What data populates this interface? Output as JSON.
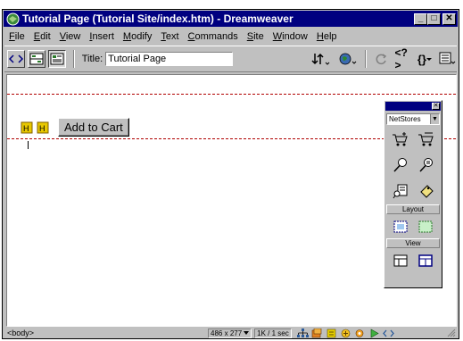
{
  "window": {
    "title": "Tutorial Page (Tutorial Site/index.htm) - Dreamweaver",
    "controls": {
      "minimize": "_",
      "maximize": "□",
      "close": "✕"
    }
  },
  "menu": [
    {
      "accel": "F",
      "rest": "ile"
    },
    {
      "accel": "E",
      "rest": "dit"
    },
    {
      "accel": "V",
      "rest": "iew"
    },
    {
      "accel": "I",
      "rest": "nsert"
    },
    {
      "accel": "M",
      "rest": "odify"
    },
    {
      "accel": "T",
      "rest": "ext"
    },
    {
      "accel": "C",
      "rest": "ommands"
    },
    {
      "accel": "S",
      "rest": "ite"
    },
    {
      "accel": "W",
      "rest": "indow"
    },
    {
      "accel": "H",
      "rest": "elp"
    }
  ],
  "toolbar": {
    "title_label": "Title:",
    "title_value": "Tutorial Page",
    "icons": [
      "code-view-icon",
      "split-view-icon",
      "design-view-icon",
      "file-transfer-icon",
      "preview-browser-icon",
      "refresh-icon",
      "code-navigation-icon",
      "braces-icon",
      "view-options-icon"
    ],
    "code_nav_label": "<?>",
    "braces_label": "{}"
  },
  "document": {
    "button_label": "Add to Cart"
  },
  "status": {
    "tag": "<body>",
    "size": "486 x 277",
    "download": "1K / 1 sec"
  },
  "palette": {
    "category": "NetStores",
    "layout_label": "Layout",
    "view_label": "View",
    "close": "✕",
    "dropdown_arrow": "▼"
  },
  "colors": {
    "titlebar": "#000080",
    "chrome": "#c0c0c0",
    "form_outline": "#b00000"
  }
}
